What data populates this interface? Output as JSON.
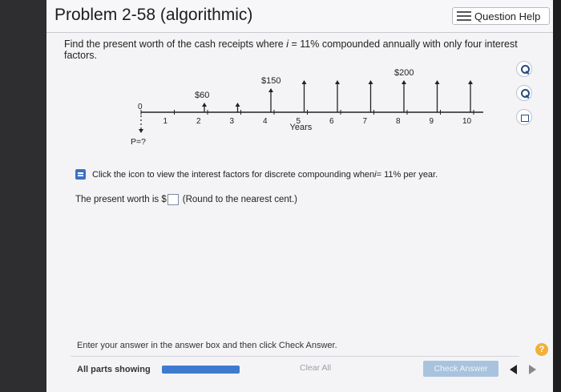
{
  "header": {
    "title": "Problem 2-58 (algorithmic)",
    "help_button": "Question Help"
  },
  "question": {
    "text_before": "Find the present worth of the cash receipts where ",
    "variable": "i",
    "text_after": " = 11% compounded annually with only four interest factors."
  },
  "cash_flow_diagram": {
    "years": [
      "0",
      "1",
      "2",
      "3",
      "4",
      "5",
      "6",
      "7",
      "8",
      "9",
      "10"
    ],
    "axis_label": "Years",
    "present_worth_label": "P=?",
    "receipts": [
      {
        "year": 2,
        "amount": 60,
        "label": "$60"
      },
      {
        "year": 3,
        "amount": 60,
        "label": ""
      },
      {
        "year": 4,
        "amount": 150,
        "label": "$150"
      },
      {
        "year": 5,
        "amount": 200,
        "label": ""
      },
      {
        "year": 6,
        "amount": 200,
        "label": ""
      },
      {
        "year": 7,
        "amount": 200,
        "label": ""
      },
      {
        "year": 8,
        "amount": 200,
        "label": "$200"
      },
      {
        "year": 9,
        "amount": 200,
        "label": ""
      },
      {
        "year": 10,
        "amount": 200,
        "label": ""
      }
    ]
  },
  "hint": {
    "text_before": "Click the icon to view the interest factors for discrete compounding when ",
    "variable": "i",
    "text_after": " = 11% per year."
  },
  "answer": {
    "prefix": "The present worth is $",
    "value": "",
    "suffix": "(Round to the nearest cent.)"
  },
  "footer": {
    "instruction": "Enter your answer in the answer box and then click Check Answer.",
    "parts_label": "All parts showing",
    "progress": 1.0,
    "clear_label": "Clear All",
    "check_label": "Check Answer",
    "help_symbol": "?"
  },
  "colors": {
    "accent": "#3e7bd0",
    "help": "#f1b03a",
    "check_disabled": "#a9c3de"
  }
}
